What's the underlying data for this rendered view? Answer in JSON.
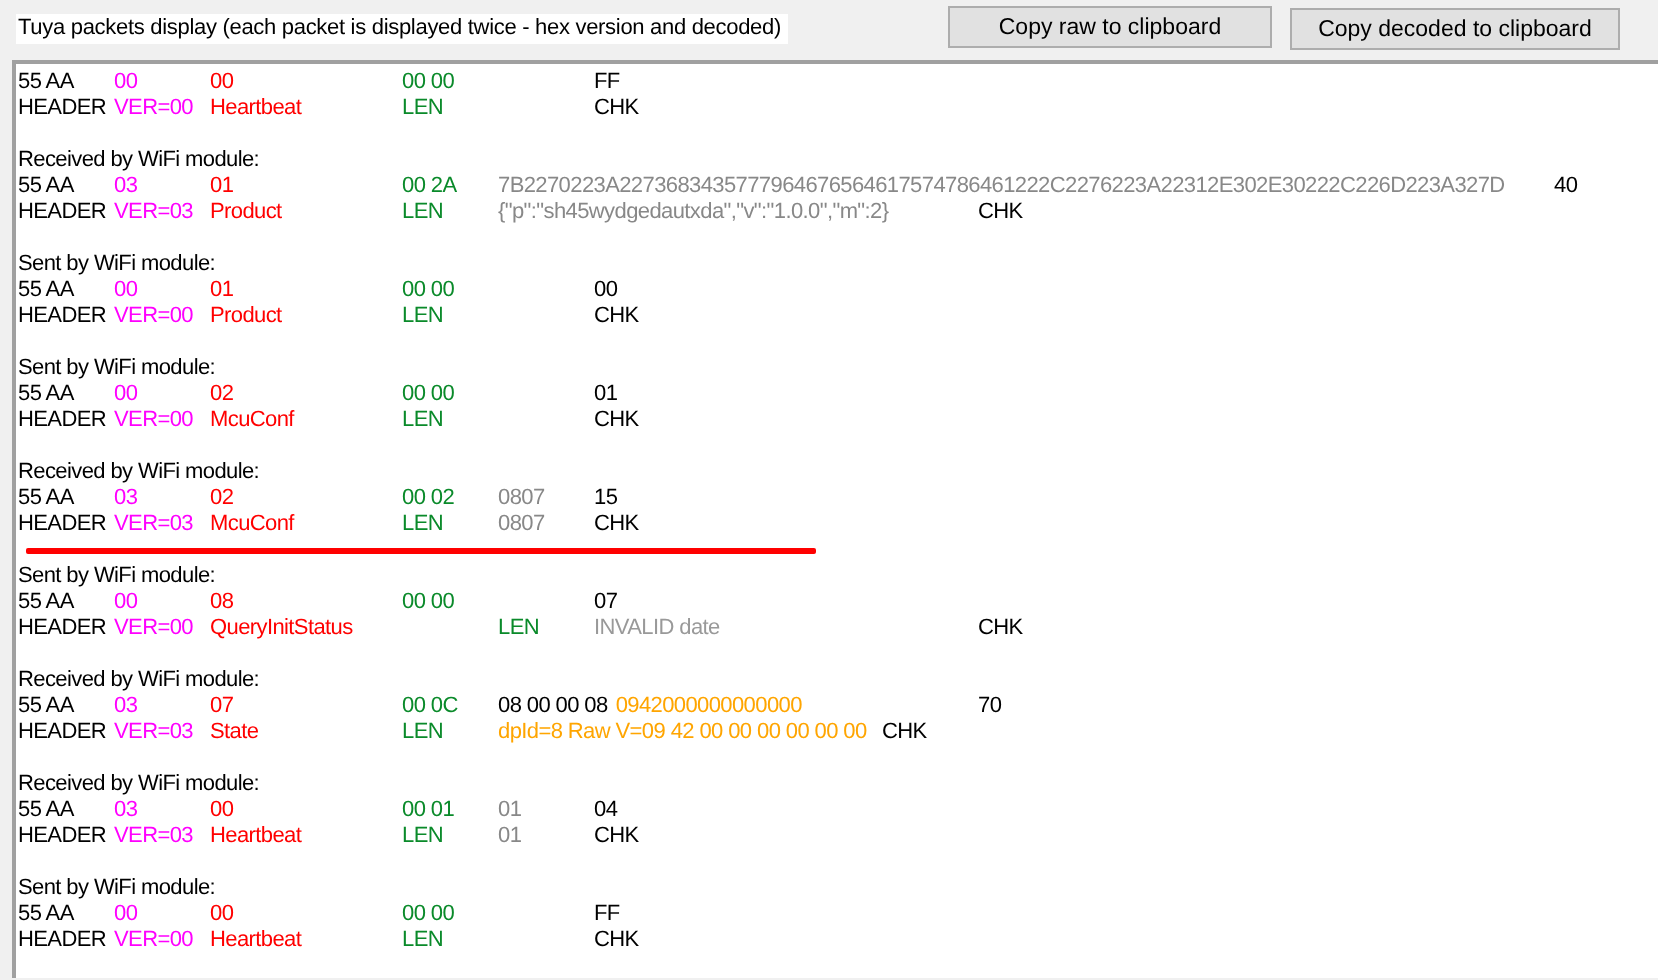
{
  "title": "Tuya packets display (each packet is displayed twice - hex version and decoded)",
  "buttons": [
    "Copy raw to clipboard",
    "Copy decoded to clipboard"
  ],
  "packets": [
    {
      "underlined": false,
      "raw": [
        {
          "text": "55 AA",
          "kind": "header"
        },
        {
          "text": "00",
          "kind": "version"
        },
        {
          "text": "00",
          "kind": "command"
        },
        {
          "text": "00 00",
          "kind": "length"
        },
        {
          "text": "FF",
          "kind": "checksum"
        }
      ],
      "decoded": [
        {
          "text": "HEADER",
          "kind": "header"
        },
        {
          "text": "VER=00",
          "kind": "version"
        },
        {
          "text": "Heartbeat",
          "kind": "command"
        },
        {
          "text": "LEN",
          "kind": "length"
        },
        {
          "text": "CHK",
          "kind": "checksum"
        }
      ]
    },
    {
      "direction": "Received by WiFi module:",
      "underlined": false,
      "raw": [
        {
          "text": "55 AA",
          "kind": "header"
        },
        {
          "text": "03",
          "kind": "version"
        },
        {
          "text": "01",
          "kind": "command"
        },
        {
          "text": "00 2A",
          "kind": "length"
        },
        {
          "text": "7B2270223A2273683435777964676564617574786461222C2276223A22312E302E30222C226D223A327D",
          "kind": "data"
        },
        {
          "text": "40",
          "kind": "checksum"
        }
      ],
      "decoded": [
        {
          "text": "HEADER",
          "kind": "header"
        },
        {
          "text": "VER=03",
          "kind": "version"
        },
        {
          "text": "Product",
          "kind": "command"
        },
        {
          "text": "LEN",
          "kind": "length"
        },
        {
          "text": "{\"p\":\"sh45wydgedautxda\",\"v\":\"1.0.0\",\"m\":2}",
          "kind": "data"
        },
        {
          "text": "CHK",
          "kind": "checksum"
        }
      ]
    },
    {
      "direction": "Sent by WiFi module:",
      "underlined": false,
      "raw": [
        {
          "text": "55 AA",
          "kind": "header"
        },
        {
          "text": "00",
          "kind": "version"
        },
        {
          "text": "01",
          "kind": "command"
        },
        {
          "text": "00 00",
          "kind": "length"
        },
        {
          "text": "00",
          "kind": "checksum"
        }
      ],
      "decoded": [
        {
          "text": "HEADER",
          "kind": "header"
        },
        {
          "text": "VER=00",
          "kind": "version"
        },
        {
          "text": "Product",
          "kind": "command"
        },
        {
          "text": "LEN",
          "kind": "length"
        },
        {
          "text": "CHK",
          "kind": "checksum"
        }
      ]
    },
    {
      "direction": "Sent by WiFi module:",
      "underlined": false,
      "raw": [
        {
          "text": "55 AA",
          "kind": "header"
        },
        {
          "text": "00",
          "kind": "version"
        },
        {
          "text": "02",
          "kind": "command"
        },
        {
          "text": "00 00",
          "kind": "length"
        },
        {
          "text": "01",
          "kind": "checksum"
        }
      ],
      "decoded": [
        {
          "text": "HEADER",
          "kind": "header"
        },
        {
          "text": "VER=00",
          "kind": "version"
        },
        {
          "text": "McuConf",
          "kind": "command"
        },
        {
          "text": "LEN",
          "kind": "length"
        },
        {
          "text": "CHK",
          "kind": "checksum"
        }
      ]
    },
    {
      "direction": "Received by WiFi module:",
      "underlined": true,
      "raw": [
        {
          "text": "55 AA",
          "kind": "header"
        },
        {
          "text": "03",
          "kind": "version"
        },
        {
          "text": "02",
          "kind": "command"
        },
        {
          "text": "00 02",
          "kind": "length"
        },
        {
          "text": "0807",
          "kind": "data"
        },
        {
          "text": "15",
          "kind": "checksum"
        }
      ],
      "decoded": [
        {
          "text": "HEADER",
          "kind": "header"
        },
        {
          "text": "VER=03",
          "kind": "version"
        },
        {
          "text": "McuConf",
          "kind": "command"
        },
        {
          "text": "LEN",
          "kind": "length"
        },
        {
          "text": "0807",
          "kind": "data"
        },
        {
          "text": "CHK",
          "kind": "checksum"
        }
      ]
    },
    {
      "direction": "Sent by WiFi module:",
      "underlined": false,
      "raw": [
        {
          "text": "55 AA",
          "kind": "header"
        },
        {
          "text": "00",
          "kind": "version"
        },
        {
          "text": "08",
          "kind": "command"
        },
        {
          "text": "00 00",
          "kind": "length"
        },
        {
          "text": "07",
          "kind": "checksum"
        }
      ],
      "decoded": [
        {
          "text": "HEADER",
          "kind": "header"
        },
        {
          "text": "VER=00",
          "kind": "version"
        },
        {
          "text": "QueryInitStatus",
          "kind": "command"
        },
        {
          "text": "LEN",
          "kind": "length"
        },
        {
          "text": "INVALID date",
          "kind": "status"
        },
        {
          "text": "CHK",
          "kind": "checksum"
        }
      ]
    },
    {
      "direction": "Received by WiFi module:",
      "underlined": false,
      "raw": [
        {
          "text": "55 AA",
          "kind": "header"
        },
        {
          "text": "03",
          "kind": "version"
        },
        {
          "text": "07",
          "kind": "command"
        },
        {
          "text": "00 0C",
          "kind": "length"
        },
        {
          "text": "08 00 00 08",
          "kind": "dp_header"
        },
        {
          "text": "0942000000000000",
          "kind": "dp_raw"
        },
        {
          "text": "70",
          "kind": "checksum"
        }
      ],
      "decoded": [
        {
          "text": "HEADER",
          "kind": "header"
        },
        {
          "text": "VER=03",
          "kind": "version"
        },
        {
          "text": "State",
          "kind": "command"
        },
        {
          "text": "LEN",
          "kind": "length"
        },
        {
          "text": "dpId=8 Raw V=09 42 00 00 00 00 00 00",
          "kind": "dp_decoded"
        },
        {
          "text": "CHK",
          "kind": "checksum"
        }
      ]
    },
    {
      "direction": "Received by WiFi module:",
      "underlined": false,
      "raw": [
        {
          "text": "55 AA",
          "kind": "header"
        },
        {
          "text": "03",
          "kind": "version"
        },
        {
          "text": "00",
          "kind": "command"
        },
        {
          "text": "00 01",
          "kind": "length"
        },
        {
          "text": "01",
          "kind": "data"
        },
        {
          "text": "04",
          "kind": "checksum"
        }
      ],
      "decoded": [
        {
          "text": "HEADER",
          "kind": "header"
        },
        {
          "text": "VER=03",
          "kind": "version"
        },
        {
          "text": "Heartbeat",
          "kind": "command"
        },
        {
          "text": "LEN",
          "kind": "length"
        },
        {
          "text": "01",
          "kind": "data"
        },
        {
          "text": "CHK",
          "kind": "checksum"
        }
      ]
    },
    {
      "direction": "Sent by WiFi module:",
      "underlined": false,
      "raw": [
        {
          "text": "55 AA",
          "kind": "header"
        },
        {
          "text": "00",
          "kind": "version"
        },
        {
          "text": "00",
          "kind": "command"
        },
        {
          "text": "00 00",
          "kind": "length"
        },
        {
          "text": "FF",
          "kind": "checksum"
        }
      ],
      "decoded": [
        {
          "text": "HEADER",
          "kind": "header"
        },
        {
          "text": "VER=00",
          "kind": "version"
        },
        {
          "text": "Heartbeat",
          "kind": "command"
        },
        {
          "text": "LEN",
          "kind": "length"
        },
        {
          "text": "CHK",
          "kind": "checksum"
        }
      ]
    }
  ]
}
